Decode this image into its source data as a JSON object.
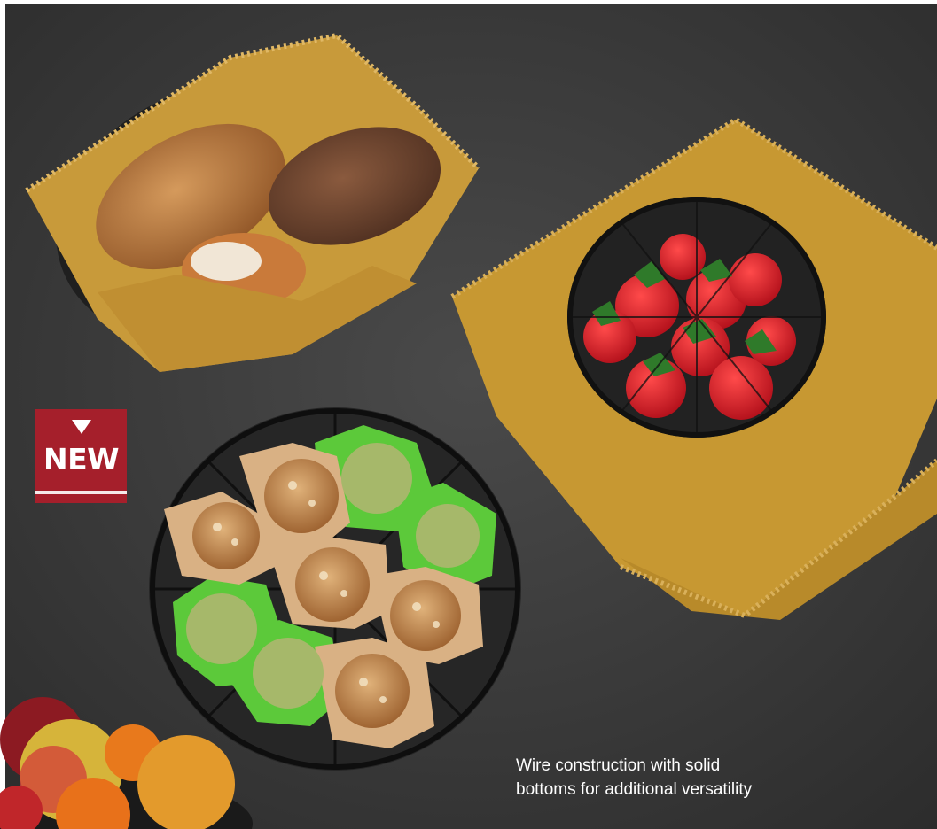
{
  "badge": {
    "label": "NEW",
    "icon": "triangle-down-icon",
    "color": "#a51f2b"
  },
  "caption": {
    "line1": "Wire construction with solid",
    "line2": "bottoms for additional versatility"
  },
  "scene": {
    "background_color": "#3b3b3b",
    "napkin_color": "#c99a35",
    "items": [
      "bread-basket",
      "strawberry-bowl",
      "muffin-basket",
      "fruit-bowl"
    ]
  }
}
